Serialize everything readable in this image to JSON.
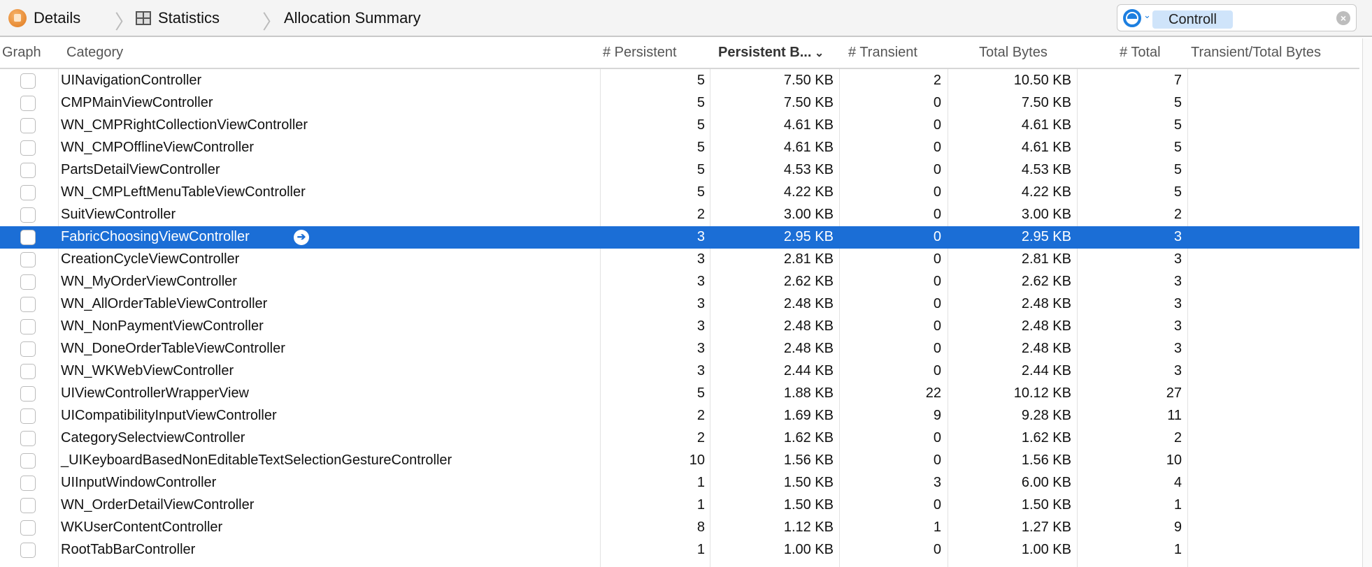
{
  "breadcrumb": [
    {
      "label": "Details",
      "icon": "instruments-icon"
    },
    {
      "label": "Statistics",
      "icon": "grid-icon"
    },
    {
      "label": "Allocation Summary"
    }
  ],
  "search": {
    "token": "Controll",
    "accent": "#1d7fe0"
  },
  "columns": [
    "Graph",
    "Category",
    "# Persistent",
    "Persistent B...",
    "# Transient",
    "Total Bytes",
    "# Total",
    "Transient/Total Bytes"
  ],
  "sorted_column": "Persistent B...",
  "sort_direction": "descending",
  "selection_color": "#1b6ed6",
  "rows": [
    [
      "UINavigationController",
      "5",
      "7.50 KB",
      "2",
      "10.50 KB",
      "7"
    ],
    [
      "CMPMainViewController",
      "5",
      "7.50 KB",
      "0",
      "7.50 KB",
      "5"
    ],
    [
      "WN_CMPRightCollectionViewController",
      "5",
      "4.61 KB",
      "0",
      "4.61 KB",
      "5"
    ],
    [
      "WN_CMPOfflineViewController",
      "5",
      "4.61 KB",
      "0",
      "4.61 KB",
      "5"
    ],
    [
      "PartsDetailViewController",
      "5",
      "4.53 KB",
      "0",
      "4.53 KB",
      "5"
    ],
    [
      "WN_CMPLeftMenuTableViewController",
      "5",
      "4.22 KB",
      "0",
      "4.22 KB",
      "5"
    ],
    [
      "SuitViewController",
      "2",
      "3.00 KB",
      "0",
      "3.00 KB",
      "2"
    ],
    [
      "FabricChoosingViewController",
      "3",
      "2.95 KB",
      "0",
      "2.95 KB",
      "3"
    ],
    [
      "CreationCycleViewController",
      "3",
      "2.81 KB",
      "0",
      "2.81 KB",
      "3"
    ],
    [
      "WN_MyOrderViewController",
      "3",
      "2.62 KB",
      "0",
      "2.62 KB",
      "3"
    ],
    [
      "WN_AllOrderTableViewController",
      "3",
      "2.48 KB",
      "0",
      "2.48 KB",
      "3"
    ],
    [
      "WN_NonPaymentViewController",
      "3",
      "2.48 KB",
      "0",
      "2.48 KB",
      "3"
    ],
    [
      "WN_DoneOrderTableViewController",
      "3",
      "2.48 KB",
      "0",
      "2.48 KB",
      "3"
    ],
    [
      "WN_WKWebViewController",
      "3",
      "2.44 KB",
      "0",
      "2.44 KB",
      "3"
    ],
    [
      "UIViewControllerWrapperView",
      "5",
      "1.88 KB",
      "22",
      "10.12 KB",
      "27"
    ],
    [
      "UICompatibilityInputViewController",
      "2",
      "1.69 KB",
      "9",
      "9.28 KB",
      "11"
    ],
    [
      "CategorySelectviewController",
      "2",
      "1.62 KB",
      "0",
      "1.62 KB",
      "2"
    ],
    [
      "_UIKeyboardBasedNonEditableTextSelectionGestureController",
      "10",
      "1.56 KB",
      "0",
      "1.56 KB",
      "10"
    ],
    [
      "UIInputWindowController",
      "1",
      "1.50 KB",
      "3",
      "6.00 KB",
      "4"
    ],
    [
      "WN_OrderDetailViewController",
      "1",
      "1.50 KB",
      "0",
      "1.50 KB",
      "1"
    ],
    [
      "WKUserContentController",
      "8",
      "1.12 KB",
      "1",
      "1.27 KB",
      "9"
    ],
    [
      "RootTabBarController",
      "1",
      "1.00 KB",
      "0",
      "1.00 KB",
      "1"
    ]
  ],
  "selected_row": 7
}
